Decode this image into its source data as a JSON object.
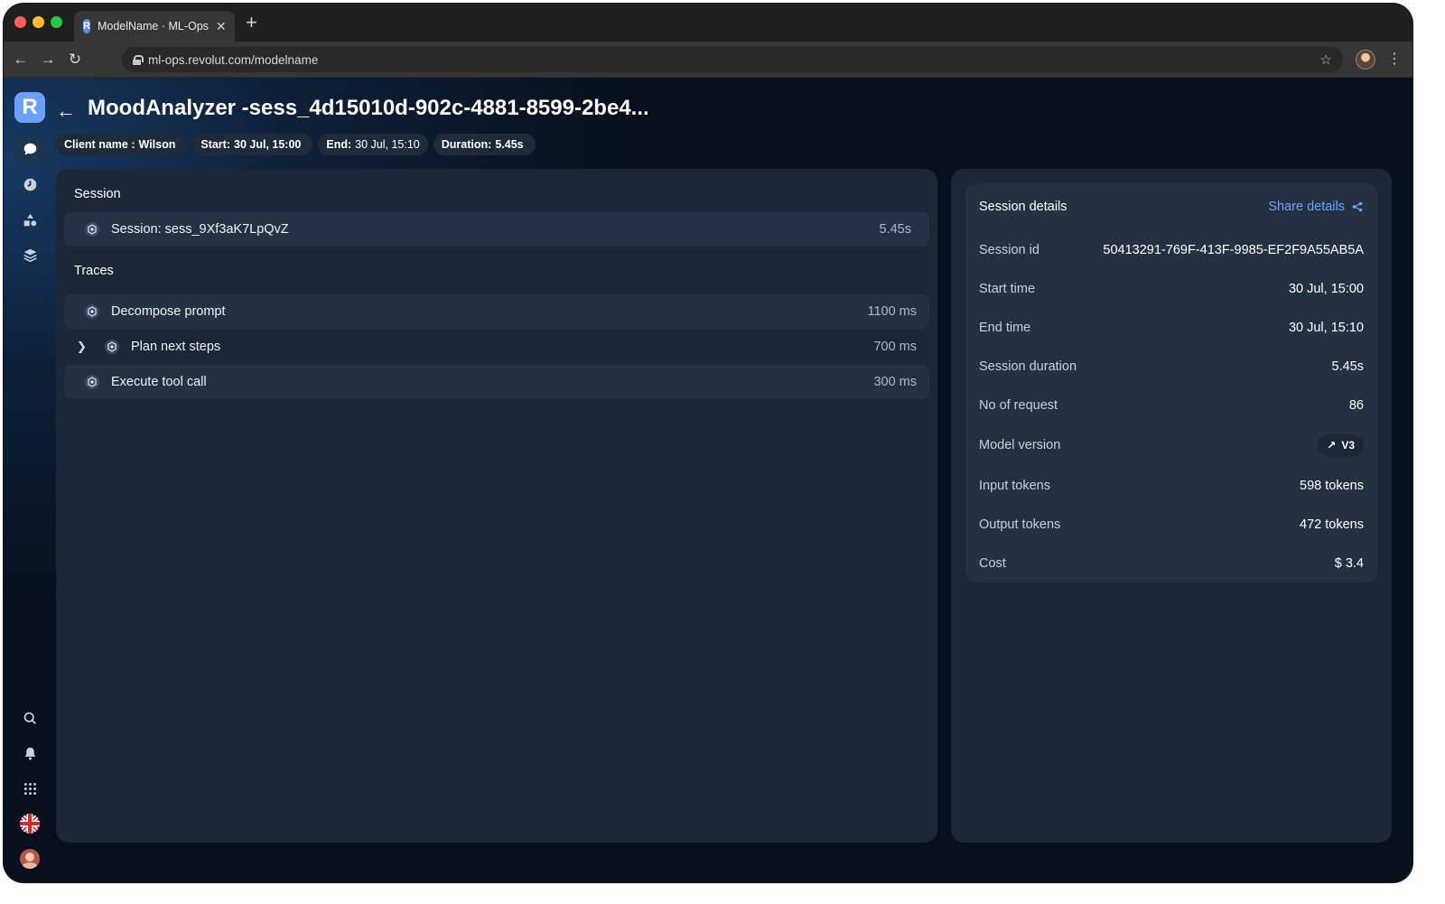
{
  "browser": {
    "tab_title": "ModelName · ML-Ops",
    "favicon_letter": "R",
    "url": "ml-ops.revolut.com/modelname"
  },
  "app": {
    "logo_letter": "R",
    "title": "MoodAnalyzer -sess_4d15010d-902c-4881-8599-2be4...",
    "chips": [
      {
        "label": "Client name :",
        "value": "Wilson"
      },
      {
        "label": "Start:",
        "value": "30 Jul, 15:00"
      },
      {
        "label": "End:",
        "value": "30 Jul, 15:10"
      },
      {
        "label": "Duration:",
        "value": "5.45s"
      }
    ]
  },
  "rail": {
    "top_icons": [
      "chat-icon",
      "clock-icon",
      "shapes-icon",
      "layers-icon"
    ],
    "bottom_icons": [
      "search-icon",
      "bell-icon",
      "apps-grid-icon",
      "uk-flag-icon",
      "user-avatar"
    ]
  },
  "left_panel": {
    "session_heading": "Session",
    "session_row": {
      "label": "Session: sess_9Xf3aK7LpQvZ",
      "value": "5.45s"
    },
    "traces_heading": "Traces",
    "traces": [
      {
        "label": "Decompose prompt",
        "value": "1100 ms"
      },
      {
        "label": "Plan next steps",
        "value": "700 ms"
      },
      {
        "label": "Execute tool call",
        "value": "300 ms"
      }
    ]
  },
  "details": {
    "title": "Session details",
    "share_label": "Share details",
    "rows": [
      {
        "label": "Session id",
        "value": "50413291-769F-413F-9985-EF2F9A55AB5A"
      },
      {
        "label": "Start time",
        "value": "30 Jul, 15:00"
      },
      {
        "label": "End time",
        "value": "30 Jul, 15:10"
      },
      {
        "label": "Session duration",
        "value": "5.45s"
      },
      {
        "label": "No of request",
        "value": "86"
      },
      {
        "label": "Model version",
        "value": "V3"
      },
      {
        "label": "Input tokens",
        "value": "598 tokens"
      },
      {
        "label": "Output tokens",
        "value": "472 tokens"
      },
      {
        "label": "Cost",
        "value": "$ 3.4"
      }
    ]
  },
  "colors": {
    "accent": "#6ea2ff",
    "panel": "#1b2636",
    "row": "#243143",
    "logo": "#6aa1ff"
  }
}
